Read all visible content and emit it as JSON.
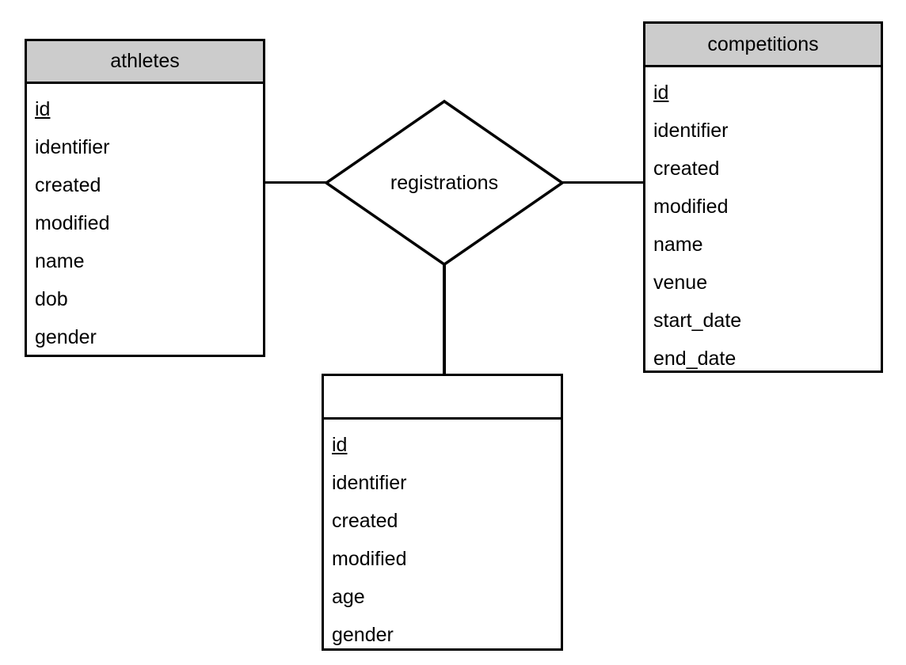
{
  "diagram": {
    "type": "entity-relationship-diagram",
    "background_color": "#ffffff",
    "line_color": "#000000",
    "header_fill": "#cccccc",
    "body_fill": "#ffffff"
  },
  "entities": [
    {
      "id": "athletes",
      "title": "athletes",
      "title_shaded": true,
      "fields": [
        {
          "name": "id",
          "primary_key": true
        },
        {
          "name": "identifier",
          "primary_key": false
        },
        {
          "name": "created",
          "primary_key": false
        },
        {
          "name": "modified",
          "primary_key": false
        },
        {
          "name": "name",
          "primary_key": false
        },
        {
          "name": "dob",
          "primary_key": false
        },
        {
          "name": "gender",
          "primary_key": false
        }
      ]
    },
    {
      "id": "competitions",
      "title": "competitions",
      "title_shaded": true,
      "fields": [
        {
          "name": "id",
          "primary_key": true
        },
        {
          "name": "identifier",
          "primary_key": false
        },
        {
          "name": "created",
          "primary_key": false
        },
        {
          "name": "modified",
          "primary_key": false
        },
        {
          "name": "name",
          "primary_key": false
        },
        {
          "name": "venue",
          "primary_key": false
        },
        {
          "name": "start_date",
          "primary_key": false
        },
        {
          "name": "end_date",
          "primary_key": false
        }
      ]
    },
    {
      "id": "unnamed",
      "title": "",
      "title_shaded": false,
      "fields": [
        {
          "name": "id",
          "primary_key": true
        },
        {
          "name": "identifier",
          "primary_key": false
        },
        {
          "name": "created",
          "primary_key": false
        },
        {
          "name": "modified",
          "primary_key": false
        },
        {
          "name": "age",
          "primary_key": false
        },
        {
          "name": "gender",
          "primary_key": false
        }
      ]
    }
  ],
  "relationships": [
    {
      "id": "registrations",
      "label": "registrations",
      "shape": "diamond",
      "connects": [
        "athletes",
        "competitions",
        "unnamed"
      ]
    }
  ]
}
